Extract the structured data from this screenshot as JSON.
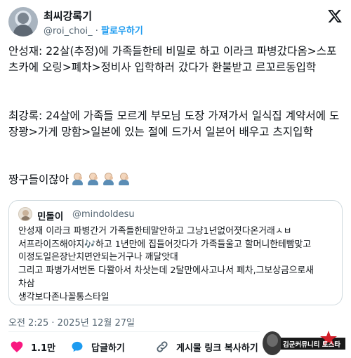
{
  "user": {
    "display_name": "최씨강록기",
    "handle": "@roi_choi_",
    "separator": "·",
    "follow_label": "팔로우하기"
  },
  "tweet": {
    "para1": "안성재: 22살(추정)에 가족들한테 비밀로 하고 이라크 파병갔다옴>스포츠카에 오링>폐차>정비사 입학하러 갔다가 환불받고 르꼬르동입학",
    "para2": "최강록: 24살에 가족들 모르게 부모님 도장 가져가서 일식집 계약서에 도장꽝>가게 망함>일본에 있는 절에 드가서 일본어 배우고 츠지입학",
    "para3": "짱구들이잖아",
    "emoji_name": "person-facepalming-emoji",
    "emoji_count": 4
  },
  "quote": {
    "display_name": "민돌이",
    "handle": "@mindoldesu",
    "lines": [
      "안성재 이라크 파병간거 가족들한테말안하고 그냥1년없어졋다온거래ㅅㅂ",
      "서프라이즈해야지🎶하고 1년만에 집들어갓다가 가족들울고 할머니한테빰맞고",
      "이정도일은장난치면안되는거구나 깨달앗대",
      "그리고 파병가서번돈 다뫌아서 차삿는데 2달만에사고나서 폐차,그보상금으로새",
      "차삼",
      "생각보다존나꼴통스타일"
    ]
  },
  "timestamp": "오전 2:25 · 2025년 12월 27일",
  "actions": {
    "like_count": "1.1만",
    "reply_label": "답글하기",
    "share_label": "게시물 링크 복사하기"
  },
  "watermark": {
    "text": "김군커뮤니티 토스타"
  },
  "colors": {
    "link": "#1d9bf0",
    "like": "#f91880",
    "secondary_text": "#536471",
    "border": "#cfd9de"
  }
}
